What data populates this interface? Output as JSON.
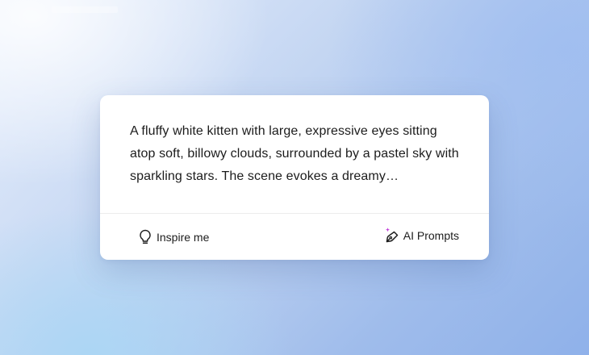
{
  "card": {
    "prompt_text": "A fluffy white kitten with large, expressive eyes sitting atop soft, billowy clouds, surrounded by a pastel sky with sparkling stars. The scene evokes a dreamy…"
  },
  "footer": {
    "inspire_label": "Inspire me",
    "inspire_icon": "lightbulb-icon",
    "ai_prompts_label": "AI Prompts",
    "ai_prompts_icon": "pen-sparkle-icon"
  },
  "colors": {
    "text": "#1c1c1c",
    "card_bg": "#ffffff",
    "sparkle_accent": "#c13fd8"
  }
}
